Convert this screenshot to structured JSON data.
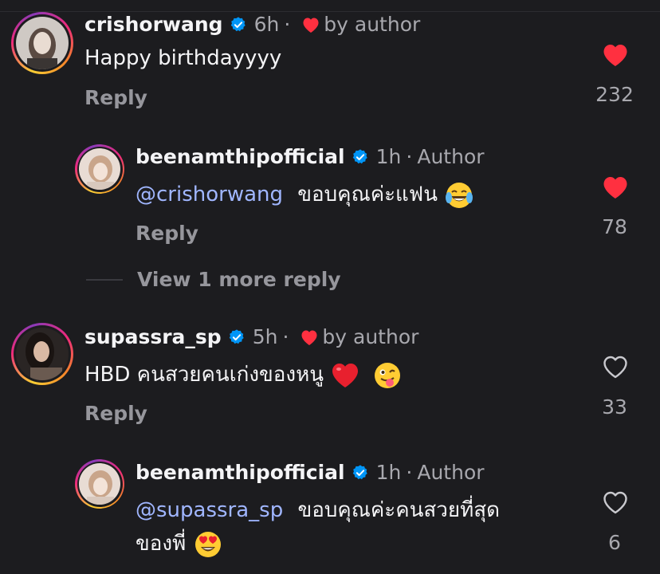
{
  "comments": [
    {
      "username": "crishorwang",
      "time": "6h",
      "liked_by": "by author",
      "text": "Happy birthdayyyy",
      "reply_label": "Reply",
      "likes": "232",
      "liked": true
    },
    {
      "username": "beenamthipofficial",
      "time": "1h",
      "author_tag": "Author",
      "mention": "@crishorwang",
      "text": "ขอบคุณค่ะแฟน",
      "emoji": "face-with-tears-of-joy",
      "reply_label": "Reply",
      "likes": "78",
      "liked": true
    },
    {
      "username": "supassra_sp",
      "time": "5h",
      "liked_by": "by author",
      "text": "HBD คนสวยคนเก่งของหนู",
      "emoji": [
        "red-heart",
        "winking-face-with-tongue"
      ],
      "reply_label": "Reply",
      "likes": "33",
      "liked": false
    },
    {
      "username": "beenamthipofficial",
      "time": "1h",
      "author_tag": "Author",
      "mention": "@supassra_sp",
      "text_line1": "ขอบคุณค่ะคนสวยที่สุด",
      "text_line2": "ของพี่",
      "emoji": "smiling-face-with-heart-eyes",
      "likes": "6",
      "liked": false
    }
  ],
  "view_more": "View 1 more reply",
  "separator": "·",
  "colors": {
    "background": "#1c1c1f",
    "like_red": "#ff3040",
    "verified_blue": "#0095f6",
    "mention": "#a0b6ff",
    "muted": "#96969c"
  }
}
